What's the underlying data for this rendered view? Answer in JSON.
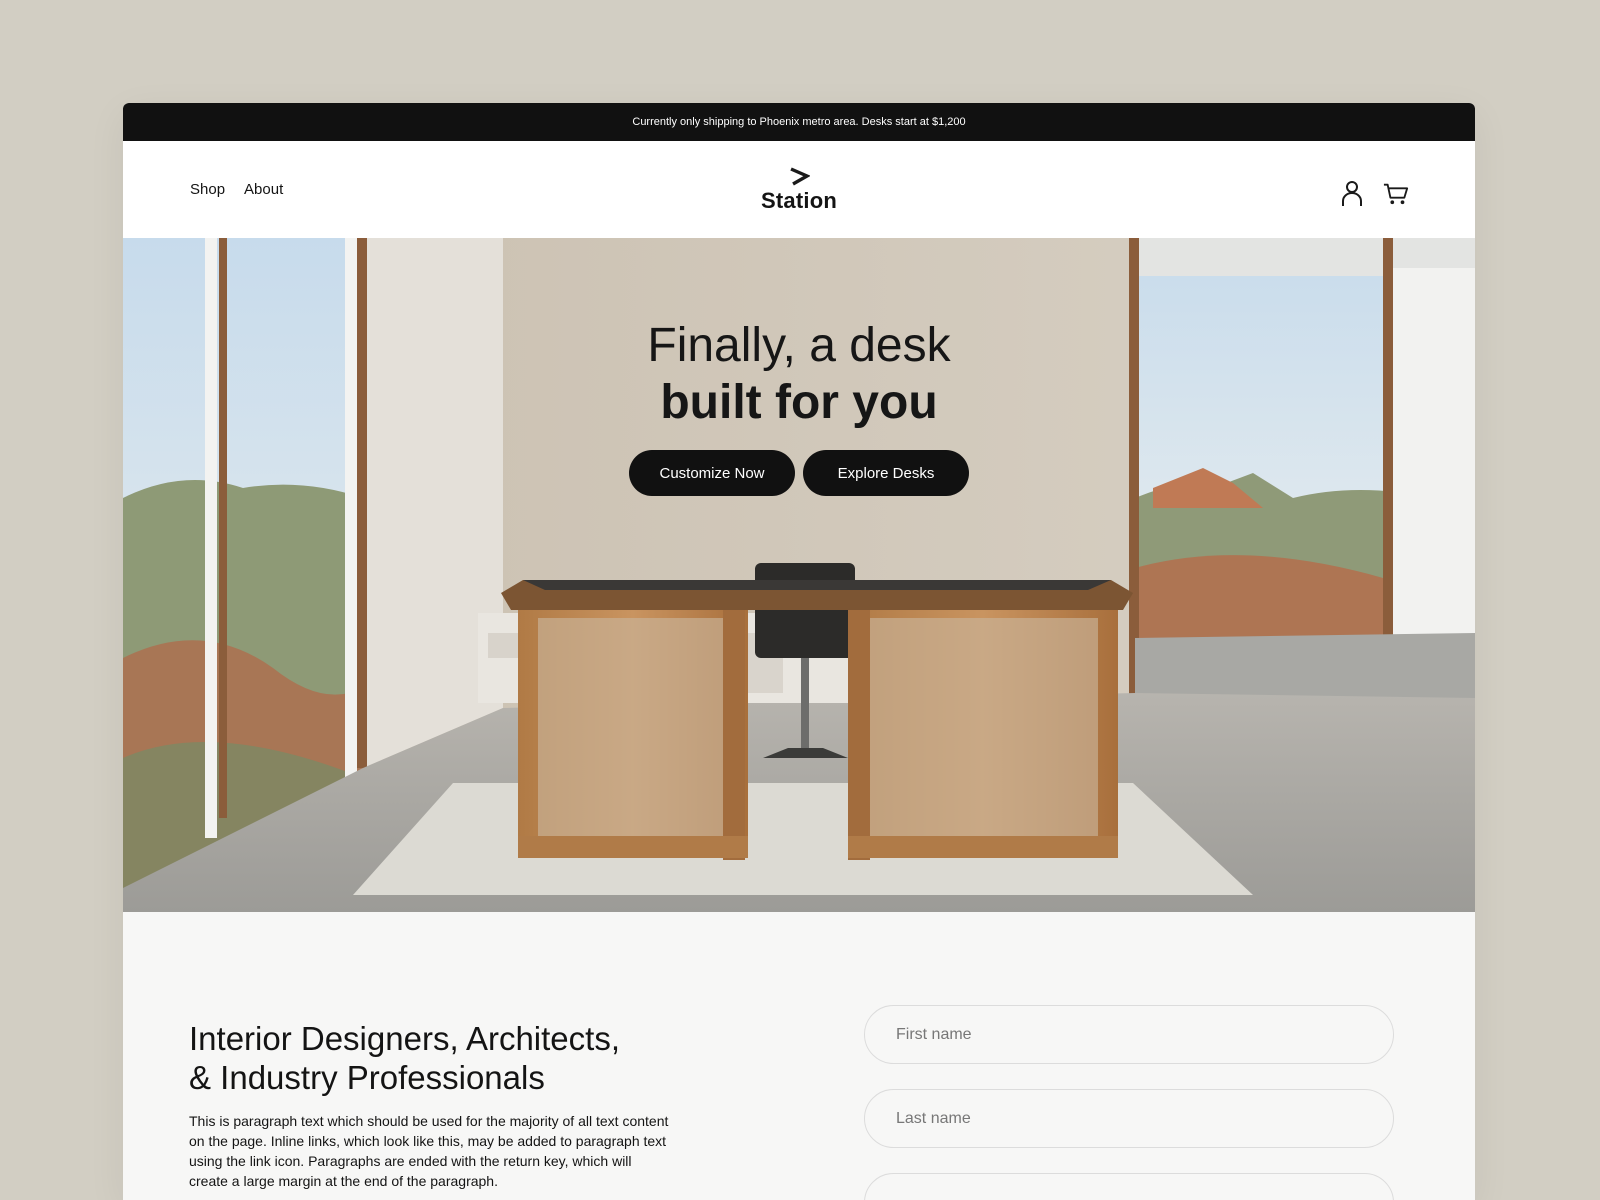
{
  "announcement": "Currently only shipping to Phoenix metro area. Desks start at $1,200",
  "nav": {
    "shop": "Shop",
    "about": "About"
  },
  "brand": {
    "name": "Station",
    "mark_icon": "chevron-right-icon"
  },
  "header_icons": [
    "user-icon",
    "cart-icon"
  ],
  "hero": {
    "line1": "Finally, a desk",
    "line2": "built for you",
    "primary_button": "Customize Now",
    "secondary_button": "Explore Desks"
  },
  "professionals": {
    "title_line1": "Interior Designers, Architects,",
    "title_line2": "& Industry Professionals",
    "body": "This is paragraph text which should be used for the majority of all text content on the page. Inline links, which look like this, may be added to paragraph text using the link icon. Paragraphs are ended with the return key, which will create a large margin at the end of the paragraph."
  },
  "form": {
    "first_name_placeholder": "First name",
    "last_name_placeholder": "Last name",
    "third_placeholder": ""
  },
  "colors": {
    "background": "#d2cec3",
    "announcement_bar": "#111111",
    "button": "#111111",
    "section": "#f7f7f6"
  }
}
